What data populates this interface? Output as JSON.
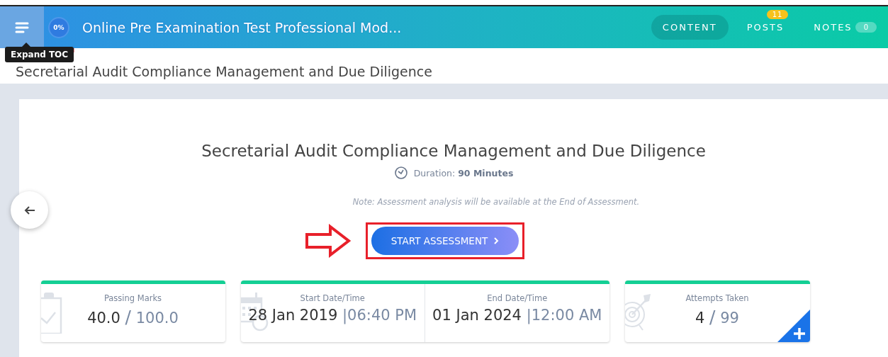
{
  "header": {
    "progress": "0%",
    "title": "Online Pre Examination Test Professional Mod...",
    "tabs": [
      {
        "label": "CONTENT",
        "selected": true
      },
      {
        "label": "POSTS",
        "selected": false,
        "badge": "11"
      },
      {
        "label": "NOTES",
        "selected": false,
        "count": "0"
      }
    ]
  },
  "tooltip": "Expand TOC",
  "subtitle": "Secretarial Audit Compliance Management and Due Diligence",
  "assessment": {
    "title": "Secretarial Audit Compliance Management and Due Diligence",
    "duration_label": "Duration:",
    "duration": "90 Minutes",
    "note": "Note: Assessment analysis will be available at the End of Assessment.",
    "start_button": "START ASSESSMENT"
  },
  "stats": [
    {
      "kind": "marks",
      "label": "Passing Marks",
      "value": "40.0",
      "separator": "/",
      "total": "100.0"
    },
    {
      "kind": "schedule",
      "items": [
        {
          "label": "Start Date/Time",
          "date": "28 Jan 2019",
          "separator": "|",
          "time": "06:40 PM"
        },
        {
          "label": "End Date/Time",
          "date": "01 Jan 2024",
          "separator": "|",
          "time": "12:00 AM"
        }
      ]
    },
    {
      "kind": "attempts",
      "label": "Attempts Taken",
      "value": "4",
      "separator": "/",
      "total": "99"
    }
  ]
}
